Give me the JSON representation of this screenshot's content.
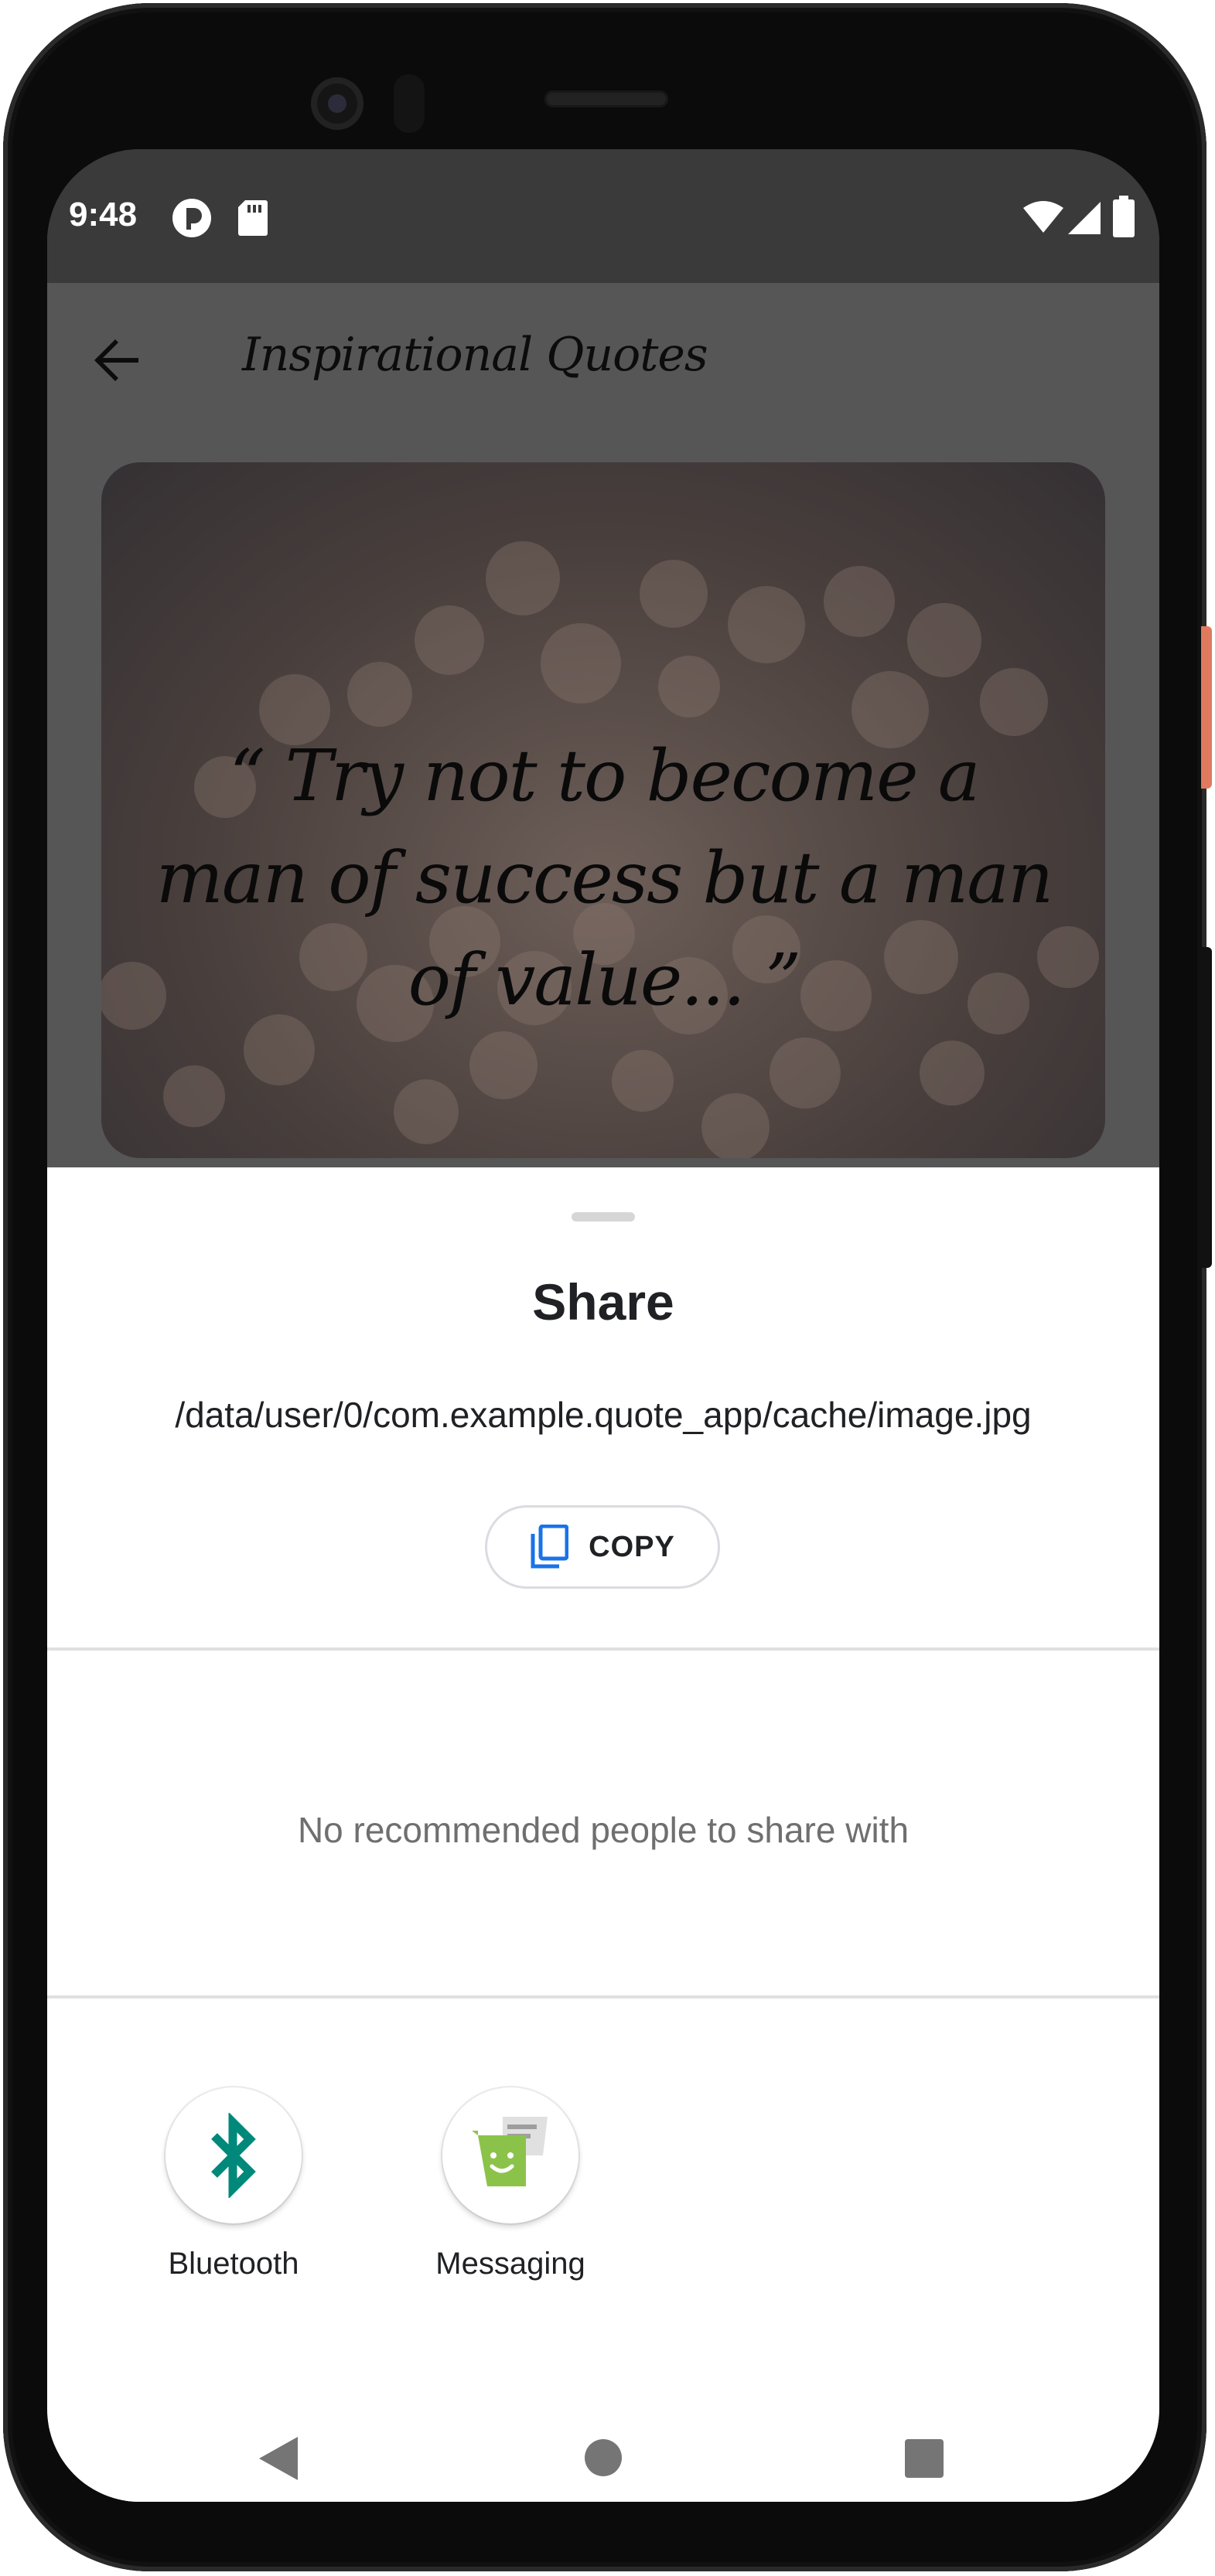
{
  "status_bar": {
    "time": "9:48",
    "left_icons": [
      "app-notification-icon",
      "sd-card-icon"
    ],
    "right_icons": [
      "wifi-icon",
      "signal-icon",
      "battery-icon"
    ]
  },
  "app_bar": {
    "title": "Inspirational Quotes",
    "back_icon": "arrow-back-icon"
  },
  "quote_card": {
    "text": "“ Try not to become a man of success but a man of value... ”"
  },
  "share_sheet": {
    "title": "Share",
    "path": "/data/user/0/com.example.quote_app/cache/image.jpg",
    "copy_label": "COPY",
    "no_people_text": "No recommended people to share with",
    "targets": [
      {
        "label": "Bluetooth",
        "icon": "bluetooth-icon"
      },
      {
        "label": "Messaging",
        "icon": "messaging-icon"
      }
    ]
  },
  "nav_bar": {
    "buttons": [
      "back-triangle-icon",
      "home-circle-icon",
      "recents-square-icon"
    ]
  },
  "colors": {
    "accent_blue": "#1a73e8",
    "bluetooth_teal": "#00897b",
    "messaging_green": "#8bc34a",
    "scrim_gray": "#565656"
  }
}
